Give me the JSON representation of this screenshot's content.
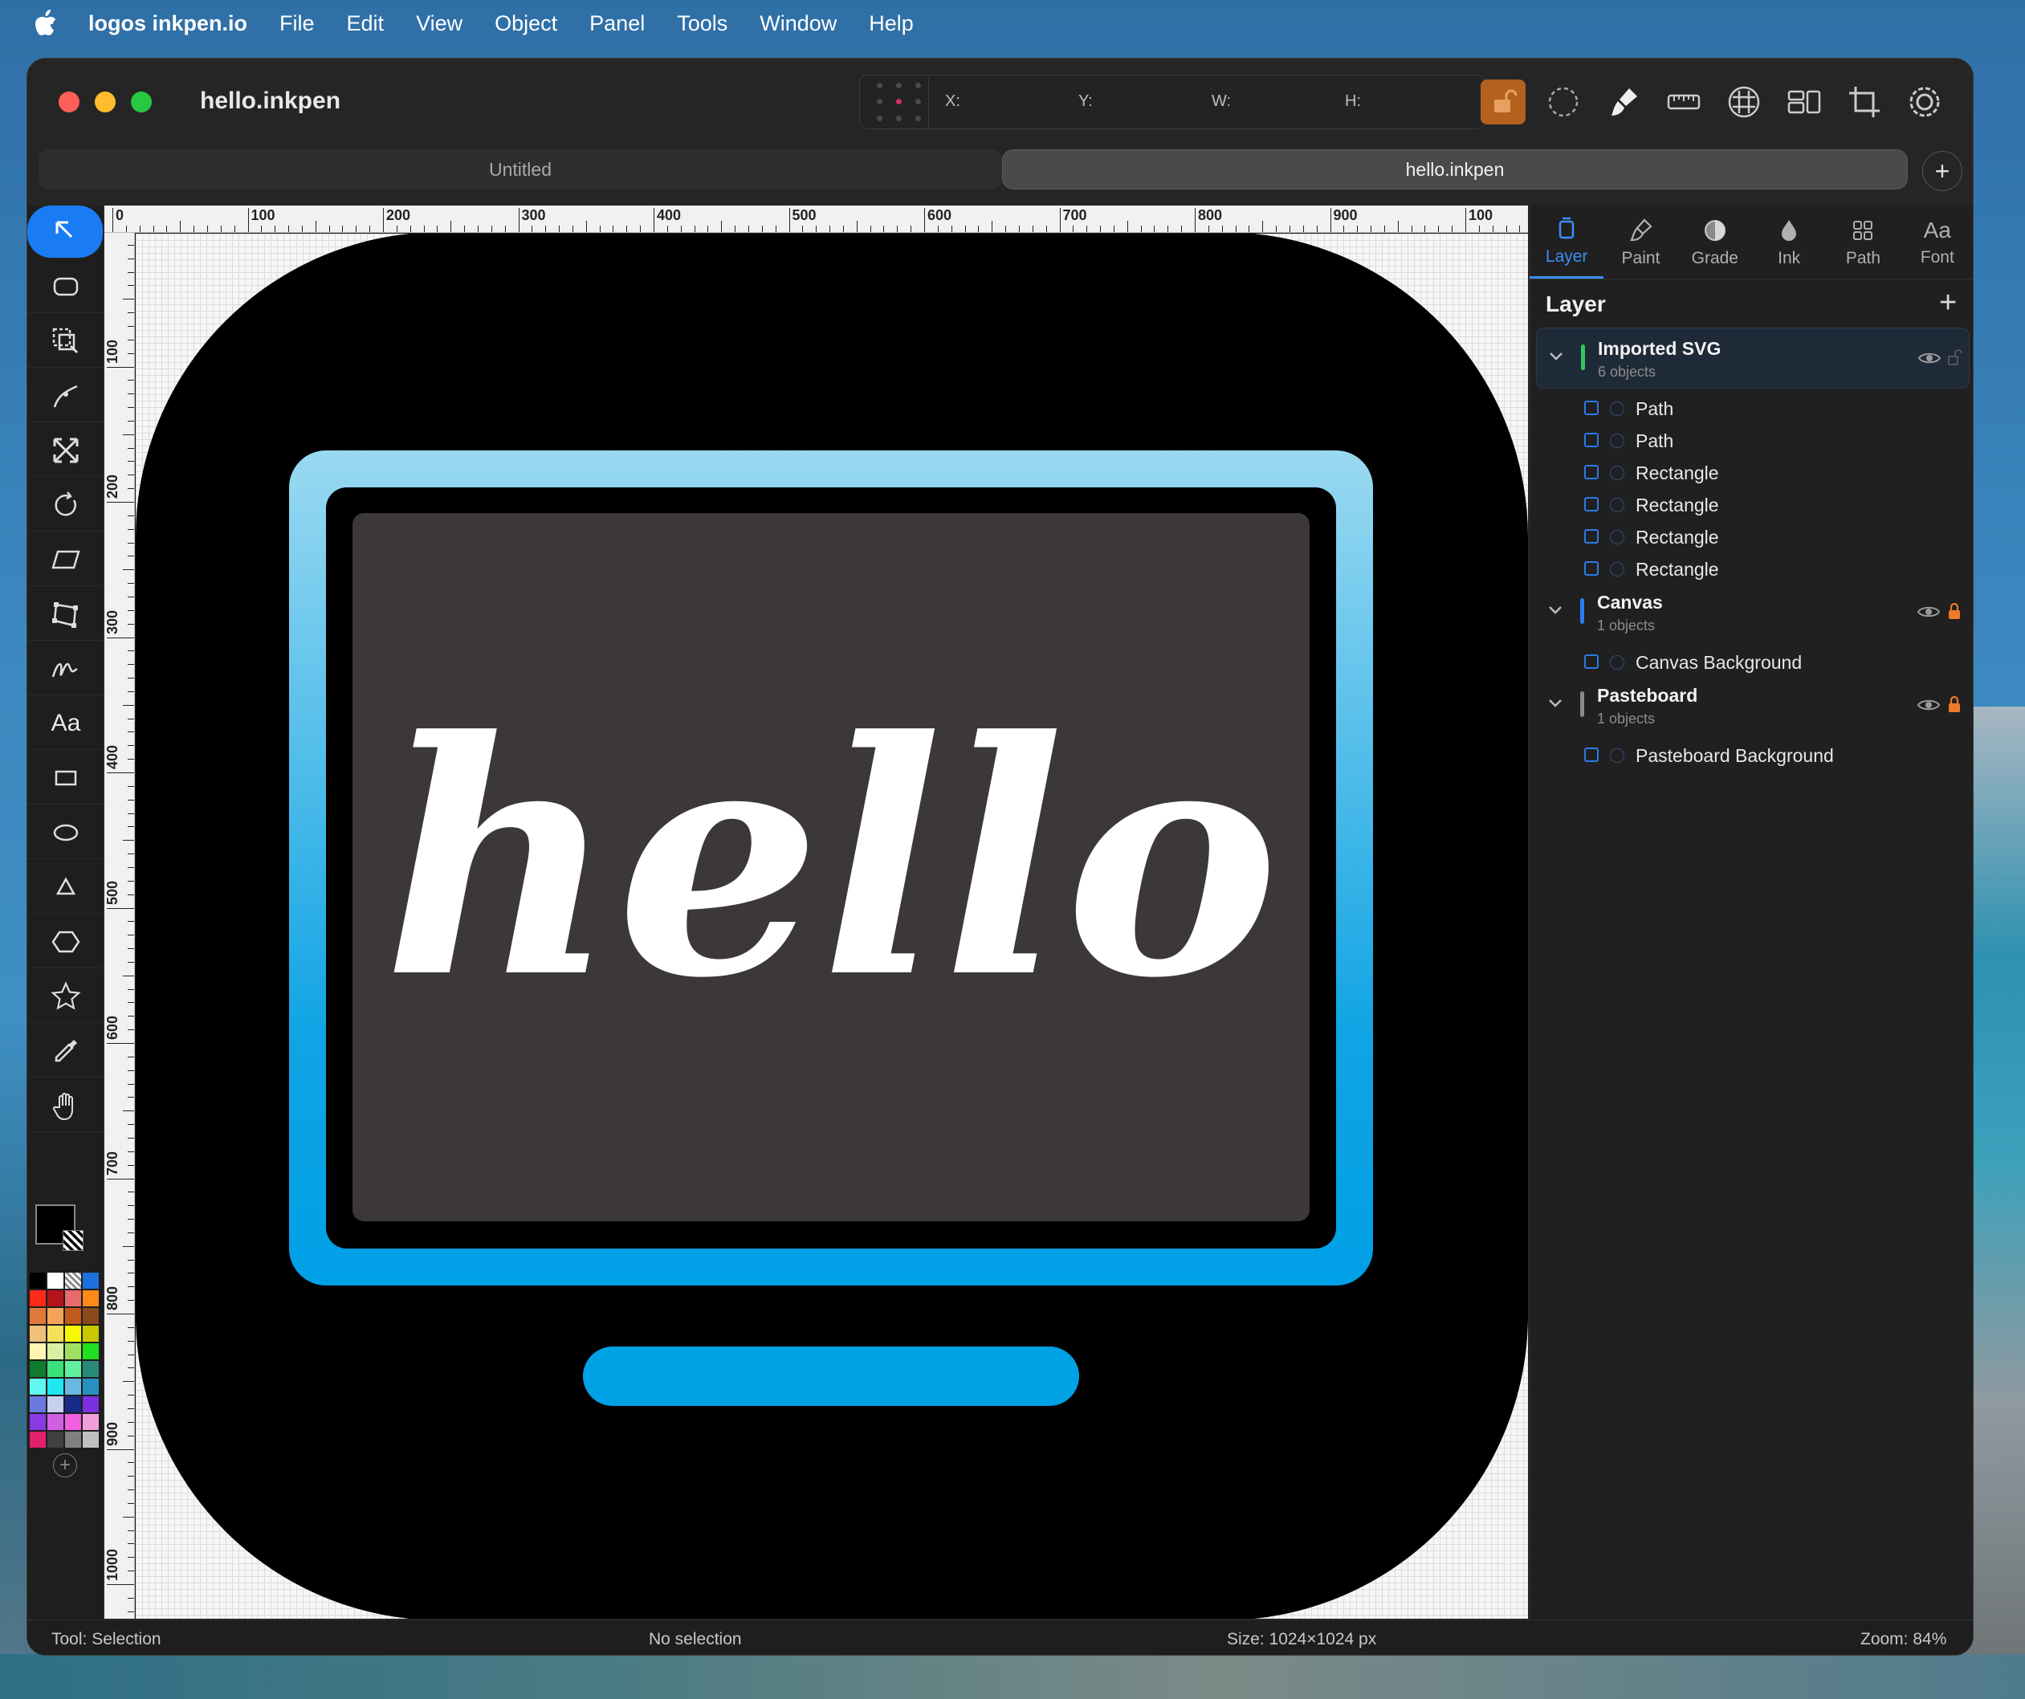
{
  "menubar": {
    "app_name": "logos inkpen.io",
    "items": [
      "File",
      "Edit",
      "View",
      "Object",
      "Panel",
      "Tools",
      "Window",
      "Help"
    ]
  },
  "window": {
    "title": "hello.inkpen",
    "coords": {
      "x_label": "X:",
      "y_label": "Y:",
      "w_label": "W:",
      "h_label": "H:"
    },
    "toolbar_icons": [
      "lock-open-icon",
      "dashed-circle-icon",
      "brush-icon",
      "ruler-icon",
      "grid-icon",
      "align-icon",
      "crop-icon",
      "settings-icon"
    ]
  },
  "tabs": {
    "items": [
      "Untitled",
      "hello.inkpen"
    ],
    "active": "hello.inkpen",
    "add": "+"
  },
  "tools": [
    "selection-tool",
    "rounded-rect-select-tool",
    "direct-select-tool",
    "pen-tool",
    "scale-tool",
    "rotate-tool",
    "shear-tool",
    "distort-tool",
    "freehand-tool",
    "text-tool",
    "rectangle-tool",
    "ellipse-tool",
    "triangle-tool",
    "polygon-tool",
    "star-tool",
    "eyedropper-tool",
    "hand-tool"
  ],
  "text_tool_label": "Aa",
  "palette_colors": [
    "#000000",
    "#ffffff",
    "checker",
    "#1e6fe0",
    "#ff2a1a",
    "#b3141a",
    "#e86b6b",
    "#ff8a1a",
    "#e07a3a",
    "#f5a35a",
    "#c05a1a",
    "#8a4a1a",
    "#f0c07a",
    "#f5e05a",
    "#f8f800",
    "#c8c800",
    "#fff5b0",
    "#d8f0a0",
    "#a0e060",
    "#20e020",
    "#107a30",
    "#3ae07a",
    "#60f0a0",
    "#2a8a7a",
    "#60f8f0",
    "#20e8f0",
    "#6ab8e0",
    "#2a90c0",
    "#6a7ae0",
    "#c8d0f0",
    "#1a2a8a",
    "#7a30e0",
    "#8a3ae0",
    "#d060e0",
    "#f060e0",
    "#f0a0d8",
    "#e0206a",
    "#404040",
    "#808080",
    "#c0c0c0"
  ],
  "ruler": {
    "top_labels": [
      "0",
      "100",
      "200",
      "300",
      "400",
      "500",
      "600",
      "700",
      "800",
      "900",
      "100"
    ],
    "left_labels": [
      "100",
      "200",
      "300",
      "400",
      "500",
      "600",
      "700",
      "800",
      "900",
      "1000"
    ]
  },
  "artwork": {
    "word": "hello"
  },
  "panel": {
    "tabs": [
      {
        "label": "Layer",
        "icon": "layer-icon"
      },
      {
        "label": "Paint",
        "icon": "paint-icon"
      },
      {
        "label": "Grade",
        "icon": "gradient-icon"
      },
      {
        "label": "Ink",
        "icon": "ink-drop-icon"
      },
      {
        "label": "Path",
        "icon": "path-grid-icon"
      },
      {
        "label": "Font",
        "icon": "font-icon"
      }
    ],
    "font_icon_text": "Aa",
    "title": "Layer",
    "add": "+",
    "groups": [
      {
        "name": "Imported SVG",
        "count": "6 objects",
        "color": "#30c85a",
        "locked": false,
        "selected": true,
        "items": [
          "Path",
          "Path",
          "Rectangle",
          "Rectangle",
          "Rectangle",
          "Rectangle"
        ]
      },
      {
        "name": "Canvas",
        "count": "1 objects",
        "color": "#2c7cf0",
        "locked": true,
        "selected": false,
        "items": [
          "Canvas Background"
        ]
      },
      {
        "name": "Pasteboard",
        "count": "1 objects",
        "color": "#8a8a8a",
        "locked": true,
        "selected": false,
        "items": [
          "Pasteboard Background"
        ]
      }
    ]
  },
  "status": {
    "tool": "Tool: Selection",
    "selection": "No selection",
    "size": "Size: 1024×1024 px",
    "zoom": "Zoom: 84%"
  }
}
